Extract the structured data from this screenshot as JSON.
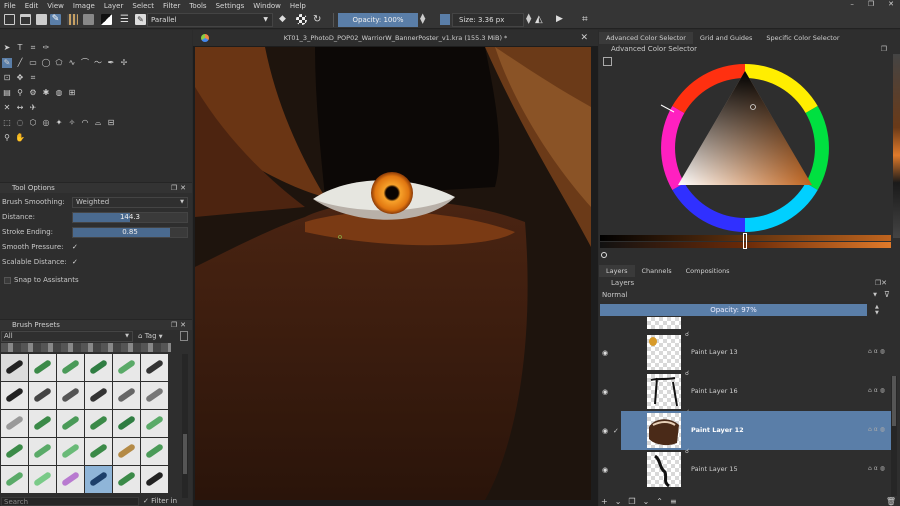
{
  "menu": [
    "File",
    "Edit",
    "View",
    "Image",
    "Layer",
    "Select",
    "Filter",
    "Tools",
    "Settings",
    "Window",
    "Help"
  ],
  "toolbar": {
    "blend_mode": "Parallel",
    "opacity_label": "Opacity: 100%",
    "size_label": "Size: 3.36 px"
  },
  "document": {
    "title": "KT01_3_PhotoD_POP02_WarriorW_BannerPoster_v1.kra (155.3 MiB) *"
  },
  "tool_options": {
    "title": "Tool Options",
    "brush_smoothing_label": "Brush Smoothing:",
    "brush_smoothing_value": "Weighted",
    "distance_label": "Distance:",
    "distance_value": "144.3",
    "stroke_ending_label": "Stroke Ending:",
    "stroke_ending_value": "0.85",
    "smooth_pressure_label": "Smooth Pressure:",
    "scalable_distance_label": "Scalable Distance:",
    "snap_label": "Snap to Assistants"
  },
  "brush_presets": {
    "title": "Brush Presets",
    "filter_value": "All",
    "tag_label": "Tag",
    "search_placeholder": "Search",
    "filter_in_tag_label": "Filter in Tag"
  },
  "color_selector": {
    "tabs": [
      "Advanced Color Selector",
      "Grid and Guides",
      "Specific Color Selector"
    ],
    "panel_title": "Advanced Color Selector",
    "accent_color": "#c0641e"
  },
  "layers": {
    "tabs": [
      "Layers",
      "Channels",
      "Compositions"
    ],
    "panel_title": "Layers",
    "blend_mode": "Normal",
    "opacity_label": "Opacity:  97%",
    "items": [
      {
        "name": "Paint Layer 13",
        "selected": false
      },
      {
        "name": "Paint Layer 16",
        "selected": false
      },
      {
        "name": "Paint Layer 12",
        "selected": true
      },
      {
        "name": "Paint Layer 15",
        "selected": false
      }
    ]
  }
}
